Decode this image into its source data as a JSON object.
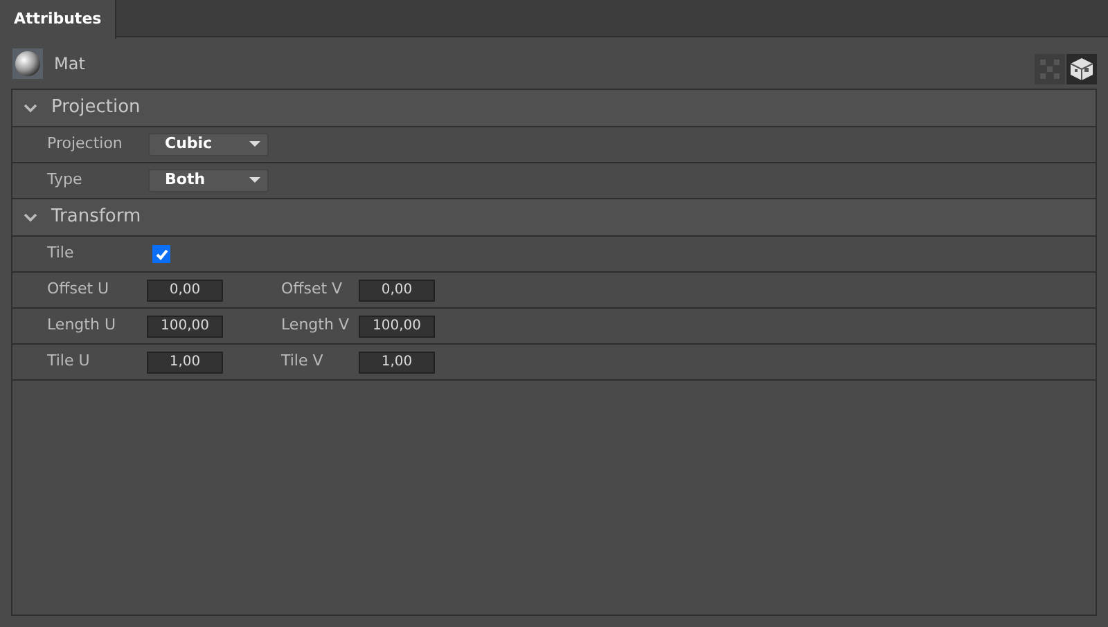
{
  "tabs": [
    {
      "label": "Attributes",
      "selected": true
    }
  ],
  "object": {
    "name": "Mat"
  },
  "view_buttons": [
    {
      "selected": false
    },
    {
      "selected": true
    }
  ],
  "sections": [
    {
      "title": "Projection",
      "expanded": true,
      "rows": [
        {
          "kind": "dropdown",
          "label": "Projection",
          "value": "Cubic"
        },
        {
          "kind": "dropdown",
          "label": "Type",
          "value": "Both"
        }
      ]
    },
    {
      "title": "Transform",
      "expanded": true,
      "rows": [
        {
          "kind": "checkbox",
          "label": "Tile",
          "checked": true
        },
        {
          "kind": "pair",
          "fields": [
            {
              "label": "Offset U",
              "value": "0,00"
            },
            {
              "label": "Offset V",
              "value": "0,00"
            }
          ]
        },
        {
          "kind": "pair",
          "fields": [
            {
              "label": "Length U",
              "value": "100,00"
            },
            {
              "label": "Length V",
              "value": "100,00"
            }
          ]
        },
        {
          "kind": "pair",
          "fields": [
            {
              "label": "Tile U",
              "value": "1,00"
            },
            {
              "label": "Tile V",
              "value": "1,00"
            }
          ]
        }
      ]
    }
  ]
}
